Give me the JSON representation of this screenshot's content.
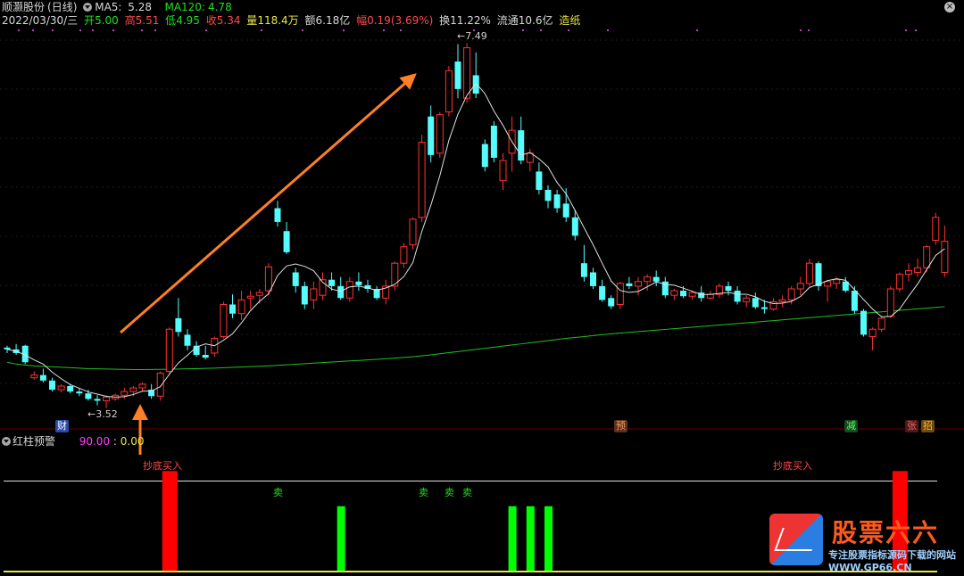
{
  "header": {
    "stock_name": "顺灏股份",
    "period": "(日线)",
    "ma5_label": "MA5:",
    "ma5_value": "5.28",
    "ma120_label": "MA120:",
    "ma120_value": "4.78",
    "date": "2022/03/30/三",
    "open_label": "开",
    "open_value": "5.00",
    "high_label": "高",
    "high_value": "5.51",
    "low_label": "低",
    "low_value": "4.95",
    "close_label": "收",
    "close_value": "5.34",
    "volume_label": "量",
    "volume_value": "118.4万",
    "amount_label": "额",
    "amount_value": "6.18亿",
    "change_label": "幅",
    "change_value": "0.19(3.69%)",
    "turnover_label": "换",
    "turnover_value": "11.22%",
    "float_label": "流通",
    "float_value": "10.6亿",
    "sector": "造纸"
  },
  "price_labels": {
    "high_tag": "7.49",
    "low_tag": "3.52"
  },
  "event_badges": {
    "cai": "财",
    "yu": "预",
    "jian": "减",
    "zhang": "张",
    "jiao": "招"
  },
  "indicator": {
    "name": "红柱预警",
    "value1": "90.00",
    "value2": "0.00",
    "buy_label_left": "抄底买入",
    "buy_label_right": "抄底买入",
    "sell_label": "卖"
  },
  "watermark": {
    "title": "股票六六",
    "subtitle": "专注股票指标源码下载的网站 WWW.GP66.CN"
  },
  "colors": {
    "up": "#ff3232",
    "down": "#54fcfc",
    "ma5": "#e0e0e0",
    "ma120": "#20c020",
    "signal_red": "#ff0000",
    "signal_green": "#00ff00",
    "arrow": "#ff7f27",
    "baseline": "#e8e84a"
  },
  "chart_data": {
    "type": "candlestick",
    "price_range": [
      3.4,
      7.65
    ],
    "candles": [
      [
        4.18,
        4.2,
        4.12,
        4.16
      ],
      [
        4.16,
        4.22,
        4.1,
        4.12
      ],
      [
        4.2,
        4.21,
        4.0,
        4.02
      ],
      [
        3.85,
        3.92,
        3.83,
        3.88
      ],
      [
        3.88,
        3.95,
        3.8,
        3.82
      ],
      [
        3.82,
        3.85,
        3.7,
        3.72
      ],
      [
        3.72,
        3.78,
        3.69,
        3.76
      ],
      [
        3.76,
        3.78,
        3.68,
        3.7
      ],
      [
        3.7,
        3.74,
        3.65,
        3.68
      ],
      [
        3.68,
        3.72,
        3.6,
        3.62
      ],
      [
        3.62,
        3.66,
        3.55,
        3.6
      ],
      [
        3.6,
        3.66,
        3.52,
        3.64
      ],
      [
        3.62,
        3.68,
        3.6,
        3.66
      ],
      [
        3.66,
        3.74,
        3.62,
        3.7
      ],
      [
        3.7,
        3.76,
        3.65,
        3.74
      ],
      [
        3.74,
        3.8,
        3.7,
        3.78
      ],
      [
        3.72,
        3.78,
        3.62,
        3.65
      ],
      [
        3.65,
        3.92,
        3.6,
        3.9
      ],
      [
        3.92,
        4.4,
        3.88,
        4.38
      ],
      [
        4.5,
        4.72,
        4.3,
        4.35
      ],
      [
        4.32,
        4.38,
        4.15,
        4.2
      ],
      [
        4.2,
        4.25,
        4.08,
        4.1
      ],
      [
        4.1,
        4.2,
        4.05,
        4.07
      ],
      [
        4.12,
        4.3,
        4.08,
        4.28
      ],
      [
        4.3,
        4.68,
        4.28,
        4.65
      ],
      [
        4.65,
        4.76,
        4.5,
        4.55
      ],
      [
        4.55,
        4.8,
        4.48,
        4.7
      ],
      [
        4.72,
        4.8,
        4.6,
        4.74
      ],
      [
        4.75,
        4.82,
        4.66,
        4.78
      ],
      [
        4.8,
        5.1,
        4.75,
        5.06
      ],
      [
        5.7,
        5.78,
        5.5,
        5.55
      ],
      [
        5.45,
        5.55,
        5.2,
        5.22
      ],
      [
        5.0,
        5.05,
        4.78,
        4.85
      ],
      [
        4.85,
        4.9,
        4.6,
        4.65
      ],
      [
        4.7,
        4.9,
        4.6,
        4.82
      ],
      [
        4.75,
        5.0,
        4.7,
        4.92
      ],
      [
        4.92,
        5.0,
        4.8,
        4.85
      ],
      [
        4.85,
        4.95,
        4.7,
        4.72
      ],
      [
        4.72,
        4.95,
        4.68,
        4.9
      ],
      [
        4.9,
        5.0,
        4.8,
        4.86
      ],
      [
        4.86,
        4.92,
        4.78,
        4.82
      ],
      [
        4.82,
        4.85,
        4.7,
        4.72
      ],
      [
        4.72,
        4.92,
        4.65,
        4.85
      ],
      [
        4.85,
        5.12,
        4.8,
        5.1
      ],
      [
        5.1,
        5.32,
        5.05,
        5.28
      ],
      [
        5.3,
        5.6,
        5.25,
        5.58
      ],
      [
        5.6,
        6.5,
        5.55,
        6.42
      ],
      [
        6.7,
        6.82,
        6.2,
        6.28
      ],
      [
        6.3,
        6.75,
        6.25,
        6.72
      ],
      [
        6.75,
        7.25,
        6.7,
        7.2
      ],
      [
        7.3,
        7.49,
        6.9,
        7.0
      ],
      [
        6.9,
        7.5,
        6.85,
        7.45
      ],
      [
        7.15,
        7.4,
        6.9,
        6.95
      ],
      [
        6.4,
        6.45,
        6.1,
        6.15
      ],
      [
        6.6,
        6.65,
        6.2,
        6.25
      ],
      [
        6.0,
        6.3,
        5.9,
        6.22
      ],
      [
        6.3,
        6.7,
        6.1,
        6.55
      ],
      [
        6.55,
        6.7,
        6.18,
        6.22
      ],
      [
        6.2,
        6.35,
        6.1,
        6.3
      ],
      [
        6.1,
        6.2,
        5.85,
        5.9
      ],
      [
        5.9,
        5.95,
        5.7,
        5.78
      ],
      [
        5.85,
        5.9,
        5.65,
        5.7
      ],
      [
        5.75,
        5.92,
        5.55,
        5.6
      ],
      [
        5.6,
        5.68,
        5.35,
        5.4
      ],
      [
        5.1,
        5.3,
        4.9,
        4.95
      ],
      [
        5.0,
        5.05,
        4.82,
        4.85
      ],
      [
        4.85,
        4.92,
        4.68,
        4.7
      ],
      [
        4.72,
        4.75,
        4.6,
        4.63
      ],
      [
        4.65,
        4.9,
        4.6,
        4.88
      ],
      [
        4.88,
        4.95,
        4.82,
        4.85
      ],
      [
        4.85,
        4.95,
        4.75,
        4.9
      ],
      [
        4.9,
        4.98,
        4.8,
        4.95
      ],
      [
        4.95,
        5.02,
        4.85,
        4.9
      ],
      [
        4.9,
        4.95,
        4.72,
        4.75
      ],
      [
        4.75,
        4.82,
        4.7,
        4.8
      ],
      [
        4.8,
        4.85,
        4.72,
        4.74
      ],
      [
        4.74,
        4.8,
        4.7,
        4.78
      ],
      [
        4.78,
        4.85,
        4.68,
        4.72
      ],
      [
        4.72,
        4.8,
        4.7,
        4.76
      ],
      [
        4.76,
        4.88,
        4.72,
        4.85
      ],
      [
        4.85,
        4.9,
        4.75,
        4.8
      ],
      [
        4.8,
        4.85,
        4.65,
        4.68
      ],
      [
        4.68,
        4.75,
        4.62,
        4.72
      ],
      [
        4.72,
        4.78,
        4.6,
        4.62
      ],
      [
        4.62,
        4.7,
        4.55,
        4.6
      ],
      [
        4.6,
        4.72,
        4.58,
        4.68
      ],
      [
        4.68,
        4.75,
        4.62,
        4.7
      ],
      [
        4.7,
        4.85,
        4.65,
        4.82
      ],
      [
        4.82,
        4.95,
        4.75,
        4.88
      ],
      [
        4.88,
        5.15,
        4.85,
        5.1
      ],
      [
        5.1,
        5.12,
        4.8,
        4.85
      ],
      [
        4.85,
        4.92,
        4.68,
        4.9
      ],
      [
        4.88,
        4.95,
        4.82,
        4.92
      ],
      [
        4.9,
        4.95,
        4.78,
        4.8
      ],
      [
        4.8,
        4.85,
        4.55,
        4.58
      ],
      [
        4.58,
        4.6,
        4.3,
        4.32
      ],
      [
        4.3,
        4.4,
        4.15,
        4.38
      ],
      [
        4.38,
        4.52,
        4.35,
        4.5
      ],
      [
        4.52,
        4.85,
        4.5,
        4.82
      ],
      [
        4.82,
        5.0,
        4.78,
        4.98
      ],
      [
        4.98,
        5.1,
        4.9,
        5.02
      ],
      [
        5.0,
        5.15,
        4.95,
        5.05
      ],
      [
        5.05,
        5.3,
        5.0,
        5.28
      ],
      [
        5.35,
        5.65,
        5.3,
        5.6
      ],
      [
        5.0,
        5.51,
        4.95,
        5.34
      ]
    ],
    "ma120": [
      4.02,
      4.0,
      3.99,
      3.98,
      3.975,
      3.97,
      3.965,
      3.96,
      3.955,
      3.95,
      3.948,
      3.946,
      3.944,
      3.942,
      3.94,
      3.94,
      3.941,
      3.942,
      3.944,
      3.946,
      3.948,
      3.95,
      3.953,
      3.956,
      3.96,
      3.964,
      3.968,
      3.972,
      3.976,
      3.98,
      3.986,
      3.992,
      3.998,
      4.004,
      4.01,
      4.016,
      4.022,
      4.028,
      4.034,
      4.04,
      4.046,
      4.052,
      4.058,
      4.065,
      4.072,
      4.08,
      4.09,
      4.1,
      4.112,
      4.124,
      4.136,
      4.148,
      4.16,
      4.172,
      4.184,
      4.196,
      4.208,
      4.22,
      4.232,
      4.244,
      4.256,
      4.268,
      4.28,
      4.29,
      4.3,
      4.31,
      4.32,
      4.33,
      4.338,
      4.346,
      4.354,
      4.362,
      4.37,
      4.378,
      4.386,
      4.394,
      4.402,
      4.41,
      4.418,
      4.426,
      4.434,
      4.442,
      4.45,
      4.458,
      4.466,
      4.474,
      4.482,
      4.49,
      4.498,
      4.506,
      4.514,
      4.522,
      4.53,
      4.538,
      4.546,
      4.554,
      4.562,
      4.57,
      4.578,
      4.586,
      4.594,
      4.602,
      4.61,
      4.618,
      4.626
    ],
    "indicator_bars": {
      "red": [
        18,
        99
      ],
      "green": [
        37,
        56,
        58,
        60
      ],
      "range": [
        0,
        110
      ],
      "red_value": 100,
      "green_value": 65
    }
  }
}
